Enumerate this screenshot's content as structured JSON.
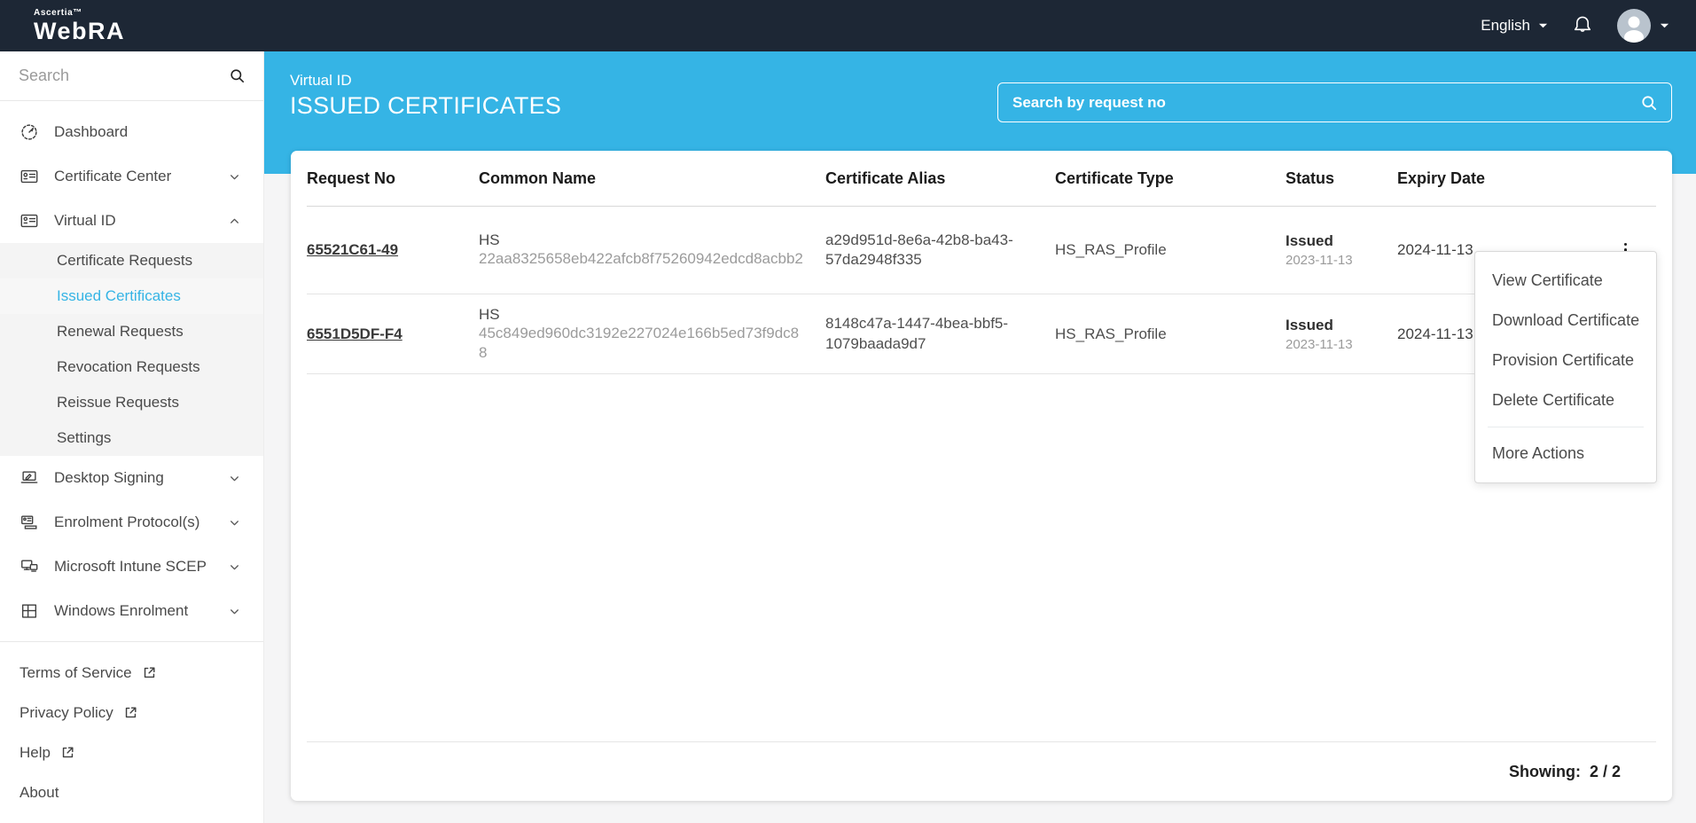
{
  "topbar": {
    "brand_top": "Ascertia™",
    "brand": "WebRA",
    "language_label": "English"
  },
  "sidebar": {
    "search_placeholder": "Search",
    "nav": [
      {
        "label": "Dashboard"
      },
      {
        "label": "Certificate Center",
        "chevron": "down"
      },
      {
        "label": "Virtual ID",
        "chevron": "up"
      }
    ],
    "submenu": [
      {
        "label": "Certificate Requests",
        "active": false
      },
      {
        "label": "Issued Certificates",
        "active": true
      },
      {
        "label": "Renewal Requests",
        "active": false
      },
      {
        "label": "Revocation Requests",
        "active": false
      },
      {
        "label": "Reissue Requests",
        "active": false
      },
      {
        "label": "Settings",
        "active": false
      }
    ],
    "nav_lower": [
      {
        "label": "Desktop Signing",
        "chevron": "down"
      },
      {
        "label": "Enrolment Protocol(s)",
        "chevron": "down"
      },
      {
        "label": "Microsoft Intune SCEP",
        "chevron": "down"
      },
      {
        "label": "Windows Enrolment",
        "chevron": "down"
      }
    ],
    "footer_links": [
      {
        "label": "Terms of Service",
        "external": true
      },
      {
        "label": "Privacy Policy",
        "external": true
      },
      {
        "label": "Help",
        "external": true
      },
      {
        "label": "About",
        "external": false
      }
    ]
  },
  "header": {
    "breadcrumb": "Virtual ID",
    "title": "ISSUED CERTIFICATES",
    "search_placeholder": "Search by request no"
  },
  "table": {
    "columns": [
      "Request No",
      "Common Name",
      "Certificate Alias",
      "Certificate Type",
      "Status",
      "Expiry Date"
    ],
    "rows": [
      {
        "request_no": "65521C61-49",
        "common_name_prefix": "HS",
        "common_name_hash": "22aa8325658eb422afcb8f75260942edcd8acbb2",
        "certificate_alias": "a29d951d-8e6a-42b8-ba43-57da2948f335",
        "certificate_type": "HS_RAS_Profile",
        "status": "Issued",
        "status_date": "2023-11-13",
        "expiry_date": "2024-11-13"
      },
      {
        "request_no": "6551D5DF-F4",
        "common_name_prefix": "HS",
        "common_name_hash": "45c849ed960dc3192e227024e166b5ed73f9dc88",
        "certificate_alias": "8148c47a-1447-4bea-bbf5-1079baada9d7",
        "certificate_type": "HS_RAS_Profile",
        "status": "Issued",
        "status_date": "2023-11-13",
        "expiry_date": "2024-11-13"
      }
    ],
    "footer": {
      "showing_label": "Showing:",
      "showing_value": "2 / 2"
    }
  },
  "context_menu": {
    "items": [
      "View Certificate",
      "Download Certificate",
      "Provision Certificate",
      "Delete Certificate"
    ],
    "more_label": "More Actions"
  },
  "icons": {
    "search": "magnifier",
    "notifications": "bell-outline",
    "user": "avatar-silhouette",
    "expand": "chevron-down",
    "collapse": "chevron-up",
    "external_link": "box-with-arrow",
    "row_actions": "vertical-ellipsis"
  },
  "colors": {
    "accent": "#35b4e5",
    "topbar_bg": "#1d2735",
    "active_link": "#35b4e5"
  }
}
